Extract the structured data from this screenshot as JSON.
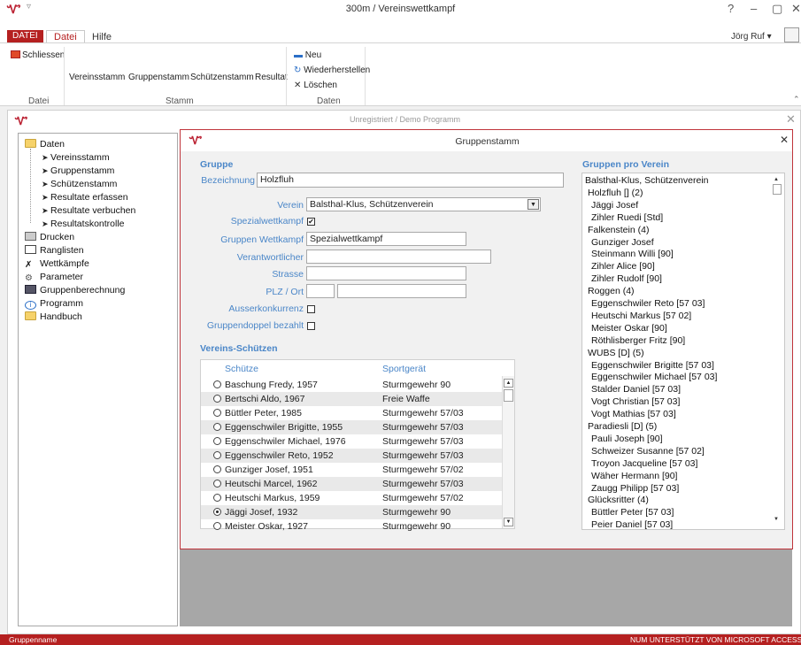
{
  "window": {
    "title": "300m / Vereinswettkampf",
    "controls": [
      "?",
      "–",
      "▢",
      "✕"
    ]
  },
  "tabs": {
    "file": "DATEI",
    "active": "Datei",
    "help": "Hilfe"
  },
  "user": {
    "name": "Jörg Ruf ▾"
  },
  "ribbon": {
    "close": "Schliessen",
    "stamm_buttons": [
      "Vereinsstamm",
      "Gruppenstamm",
      "Schützenstamm",
      "Resultat"
    ],
    "neu": "Neu",
    "wiederherstellen": "Wiederherstellen",
    "loeschen": "Löschen",
    "groups": [
      "Datei",
      "Stamm",
      "Daten"
    ]
  },
  "inner": {
    "title": "Unregistriert / Demo Programm"
  },
  "tree": {
    "root": "Daten",
    "children": [
      "Vereinsstamm",
      "Gruppenstamm",
      "Schützenstamm",
      "Resultate erfassen",
      "Resultate verbuchen",
      "Resultatskontrolle"
    ],
    "items": [
      "Drucken",
      "Ranglisten",
      "Wettkämpfe",
      "Parameter",
      "Gruppenberechnung",
      "Programm",
      "Handbuch"
    ]
  },
  "form": {
    "title": "Gruppenstamm",
    "section_gruppe": "Gruppe",
    "bezeichnung_label": "Bezeichnung",
    "bezeichnung_value": "Holzfluh",
    "verein_label": "Verein",
    "verein_value": "Balsthal-Klus, Schützenverein",
    "spezial_label": "Spezialwettkampf",
    "spezial_checked": "✔",
    "gw_label": "Gruppen Wettkampf",
    "gw_value": "Spezialwettkampf",
    "verantw_label": "Verantwortlicher",
    "strasse_label": "Strasse",
    "plz_label": "PLZ / Ort",
    "ausser_label": "Ausserkonkurrenz",
    "doppel_label": "Gruppendoppel bezahlt",
    "section_schuetzen": "Vereins-Schützen",
    "col_schuetze": "Schütze",
    "col_geraet": "Sportgerät",
    "shooters": [
      {
        "name": "Baschung Fredy, 1957",
        "weapon": "Sturmgewehr 90",
        "selected": false
      },
      {
        "name": "Bertschi Aldo, 1967",
        "weapon": "Freie Waffe",
        "selected": false
      },
      {
        "name": "Büttler Peter, 1985",
        "weapon": "Sturmgewehr 57/03",
        "selected": false
      },
      {
        "name": "Eggenschwiler Brigitte, 1955",
        "weapon": "Sturmgewehr 57/03",
        "selected": false
      },
      {
        "name": "Eggenschwiler Michael, 1976",
        "weapon": "Sturmgewehr 57/03",
        "selected": false
      },
      {
        "name": "Eggenschwiler Reto, 1952",
        "weapon": "Sturmgewehr 57/03",
        "selected": false
      },
      {
        "name": "Gunziger Josef, 1951",
        "weapon": "Sturmgewehr 57/02",
        "selected": false
      },
      {
        "name": "Heutschi Marcel, 1962",
        "weapon": "Sturmgewehr 57/03",
        "selected": false
      },
      {
        "name": "Heutschi Markus, 1959",
        "weapon": "Sturmgewehr 57/02",
        "selected": false
      },
      {
        "name": "Jäggi Josef, 1932",
        "weapon": "Sturmgewehr 90",
        "selected": true
      },
      {
        "name": "Meister Oskar, 1927",
        "weapon": "Sturmgewehr 90",
        "selected": false
      }
    ],
    "section_pro_verein": "Gruppen pro Verein",
    "pro_verein": [
      {
        "t": "Balsthal-Klus, Schützenverein",
        "lvl": 0
      },
      {
        "t": "Holzfluh  []  (2)",
        "lvl": 1
      },
      {
        "t": "Jäggi Josef",
        "lvl": 2
      },
      {
        "t": "Zihler Ruedi  [Std]",
        "lvl": 2
      },
      {
        "t": "Falkenstein    (4)",
        "lvl": 1
      },
      {
        "t": "Gunziger Josef",
        "lvl": 2
      },
      {
        "t": "Steinmann Willi  [90]",
        "lvl": 2
      },
      {
        "t": "Zihler Alice  [90]",
        "lvl": 2
      },
      {
        "t": "Zihler Rudolf  [90]",
        "lvl": 2
      },
      {
        "t": "Roggen    (4)",
        "lvl": 1
      },
      {
        "t": "Eggenschwiler Reto  [57 03]",
        "lvl": 2
      },
      {
        "t": "Heutschi Markus  [57 02]",
        "lvl": 2
      },
      {
        "t": "Meister Oskar  [90]",
        "lvl": 2
      },
      {
        "t": "Röthlisberger Fritz  [90]",
        "lvl": 2
      },
      {
        "t": "WUBS  [D]  (5)",
        "lvl": 1
      },
      {
        "t": "Eggenschwiler Brigitte  [57 03]",
        "lvl": 2
      },
      {
        "t": "Eggenschwiler Michael  [57 03]",
        "lvl": 2
      },
      {
        "t": "Stalder Daniel  [57 03]",
        "lvl": 2
      },
      {
        "t": "Vogt Christian  [57 03]",
        "lvl": 2
      },
      {
        "t": "Vogt Mathias  [57 03]",
        "lvl": 2
      },
      {
        "t": "Paradiesli  [D]  (5)",
        "lvl": 1
      },
      {
        "t": "Pauli Joseph  [90]",
        "lvl": 2
      },
      {
        "t": "Schweizer Susanne  [57 02]",
        "lvl": 2
      },
      {
        "t": "Troyon Jacqueline  [57 03]",
        "lvl": 2
      },
      {
        "t": "Wäher Hermann  [90]",
        "lvl": 2
      },
      {
        "t": "Zaugg Philipp  [57 03]",
        "lvl": 2
      },
      {
        "t": "Glücksritter    (4)",
        "lvl": 1
      },
      {
        "t": "Büttler Peter  [57 03]",
        "lvl": 2
      },
      {
        "t": "Peier Daniel  [57 03]",
        "lvl": 2
      }
    ]
  },
  "status": {
    "left": "Gruppenname",
    "right": "NUM    UNTERSTÜTZT VON MICROSOFT ACCESS"
  }
}
